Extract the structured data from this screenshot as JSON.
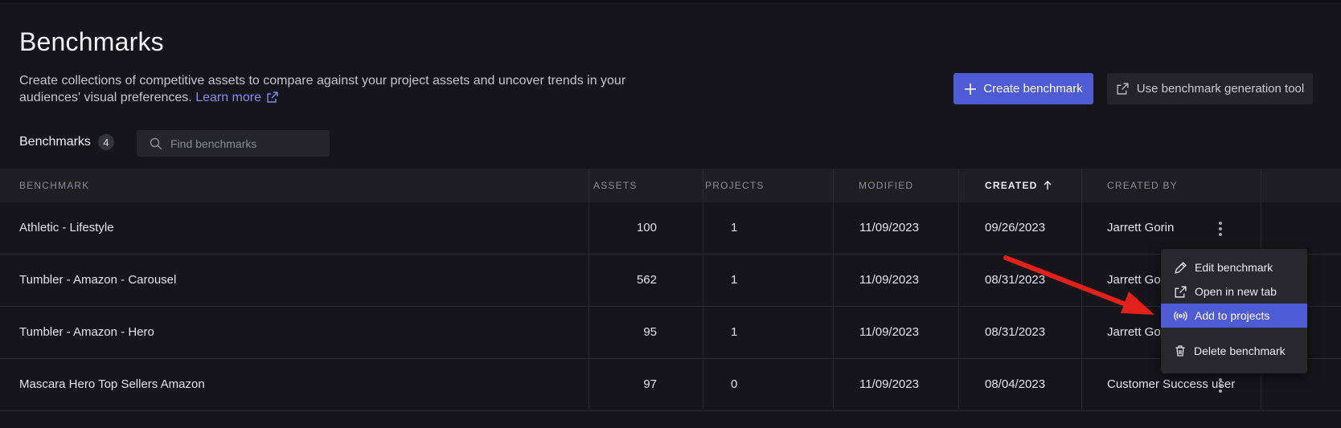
{
  "header": {
    "title": "Benchmarks",
    "description": "Create collections of competitive assets to compare against your project assets and uncover trends in your audiences' visual preferences.",
    "learn_more": "Learn more"
  },
  "actions": {
    "create_label": "Create benchmark",
    "generation_tool_label": "Use benchmark generation tool"
  },
  "toolbar": {
    "count_label": "Benchmarks",
    "count": "4",
    "search_placeholder": "Find benchmarks"
  },
  "table": {
    "columns": {
      "benchmark": "BENCHMARK",
      "assets": "ASSETS",
      "projects": "PROJECTS",
      "modified": "MODIFIED",
      "created": "CREATED",
      "created_by": "CREATED BY"
    },
    "sort": {
      "column": "created",
      "direction": "ascending"
    },
    "rows": [
      {
        "name": "Athletic - Lifestyle",
        "assets": "100",
        "projects": "1",
        "modified": "11/09/2023",
        "created": "09/26/2023",
        "created_by": "Jarrett Gorin"
      },
      {
        "name": "Tumbler - Amazon - Carousel",
        "assets": "562",
        "projects": "1",
        "modified": "11/09/2023",
        "created": "08/31/2023",
        "created_by": "Jarrett Gorin"
      },
      {
        "name": "Tumbler - Amazon - Hero",
        "assets": "95",
        "projects": "1",
        "modified": "11/09/2023",
        "created": "08/31/2023",
        "created_by": "Jarrett Gorin"
      },
      {
        "name": "Mascara Hero Top Sellers Amazon",
        "assets": "97",
        "projects": "0",
        "modified": "11/09/2023",
        "created": "08/04/2023",
        "created_by": "Customer Success user"
      }
    ]
  },
  "context_menu": {
    "items": [
      {
        "label": "Edit benchmark",
        "icon": "pencil-icon"
      },
      {
        "label": "Open in new tab",
        "icon": "external-link-icon"
      },
      {
        "label": "Add to projects",
        "icon": "broadcast-icon",
        "selected": true
      },
      {
        "label": "Delete benchmark",
        "icon": "trash-icon"
      }
    ]
  },
  "colors": {
    "background": "#16161a",
    "accent": "#4f5bd5",
    "link": "#8f86f0",
    "annotation_arrow": "#e3201b"
  }
}
